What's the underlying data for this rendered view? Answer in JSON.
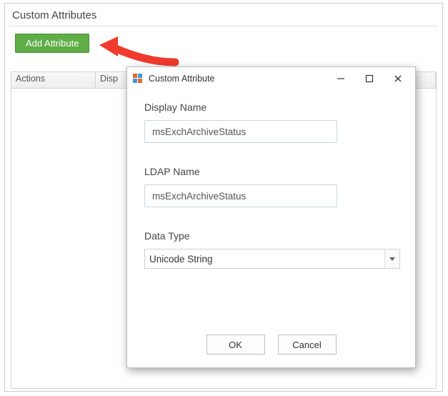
{
  "section": {
    "title": "Custom Attributes"
  },
  "toolbar": {
    "add_attribute_label": "Add Attribute"
  },
  "table": {
    "columns": {
      "actions": "Actions",
      "display_name": "Disp"
    }
  },
  "dialog": {
    "title": "Custom Attribute",
    "fields": {
      "display_name": {
        "label": "Display Name",
        "value": "msExchArchiveStatus"
      },
      "ldap_name": {
        "label": "LDAP Name",
        "value": "msExchArchiveStatus"
      },
      "data_type": {
        "label": "Data Type",
        "value": "Unicode String"
      }
    },
    "buttons": {
      "ok": "OK",
      "cancel": "Cancel"
    }
  }
}
